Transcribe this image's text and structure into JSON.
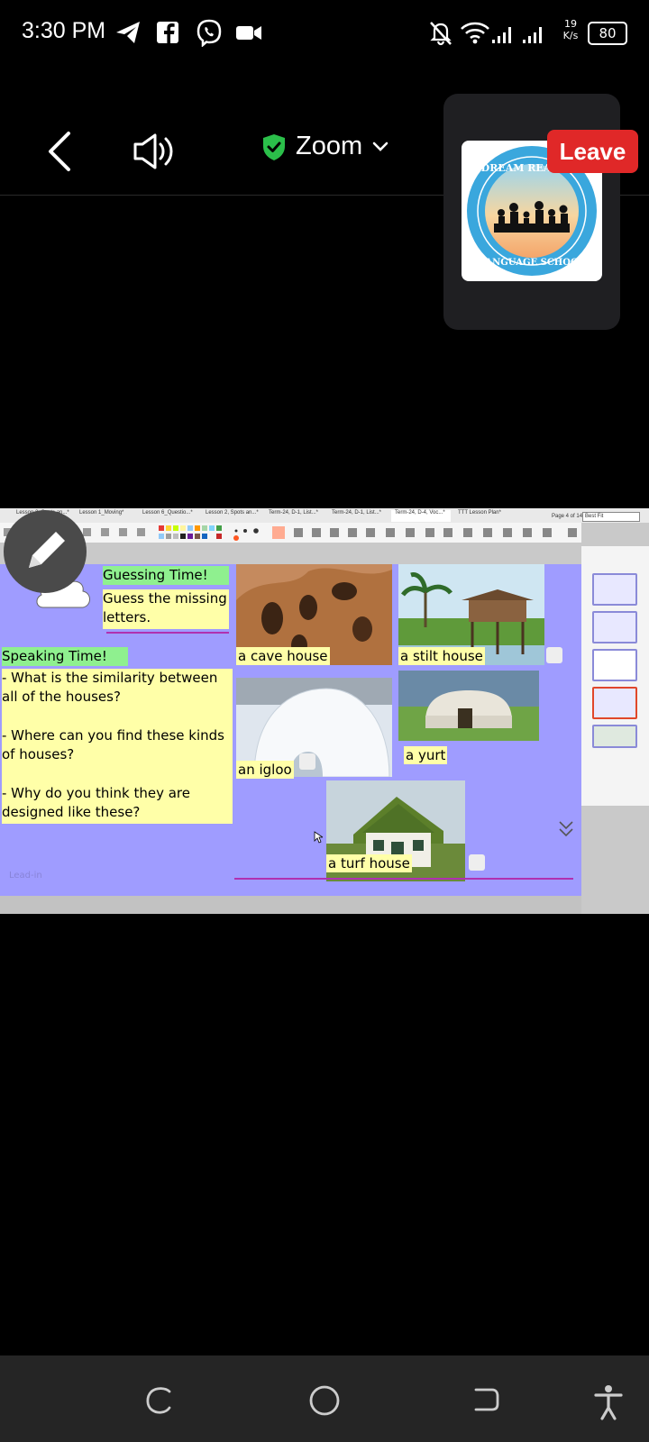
{
  "status_bar": {
    "time": "3:30 PM",
    "net_speed_value": "19",
    "net_speed_unit": "K/s",
    "battery": "80",
    "icons": [
      "telegram-icon",
      "facebook-icon",
      "viber-icon",
      "video-icon",
      "mute-bell-icon",
      "wifi-icon",
      "signal-icon"
    ]
  },
  "zoom": {
    "title": "Zoom",
    "leave_label": "Leave",
    "avatar_text_top": "DREAM READERS",
    "avatar_text_bottom": "LANGUAGE SCHOOL"
  },
  "presentation": {
    "tabs": [
      "Lesson 2, Spots an...*",
      "Lesson 1_Moving*",
      "Lesson 6_Questio...*",
      "Lesson 2, Spots an...*",
      "Term-24, D-1, List...*",
      "Term-24, D-1, List...*",
      "Term-24, D-4, Voc...*",
      "TTT Lesson Plan*"
    ],
    "active_tab_index": 6,
    "page_indicator": "Page 4 of 14",
    "zoom_select": "Best Fit",
    "slide": {
      "guessing_title": "Guessing Time!",
      "guessing_text": "Guess the missing letters.",
      "speaking_title": "Speaking Time!",
      "speaking_q1": "- What is the similarity between all of the houses?",
      "speaking_q2": "- Where can you find these kinds of houses?",
      "speaking_q3": "- Why do you think they are designed like these?",
      "caption_cave": "a cave house",
      "caption_stilt": "a stilt house",
      "caption_igloo": "an igloo",
      "caption_yurt": "a yurt",
      "caption_turf": "a turf house",
      "footer_label": "Lead-in"
    }
  },
  "colors": {
    "leave": "#e02828",
    "slide_bg": "#9f9cff",
    "shield": "#2bbf4a"
  }
}
